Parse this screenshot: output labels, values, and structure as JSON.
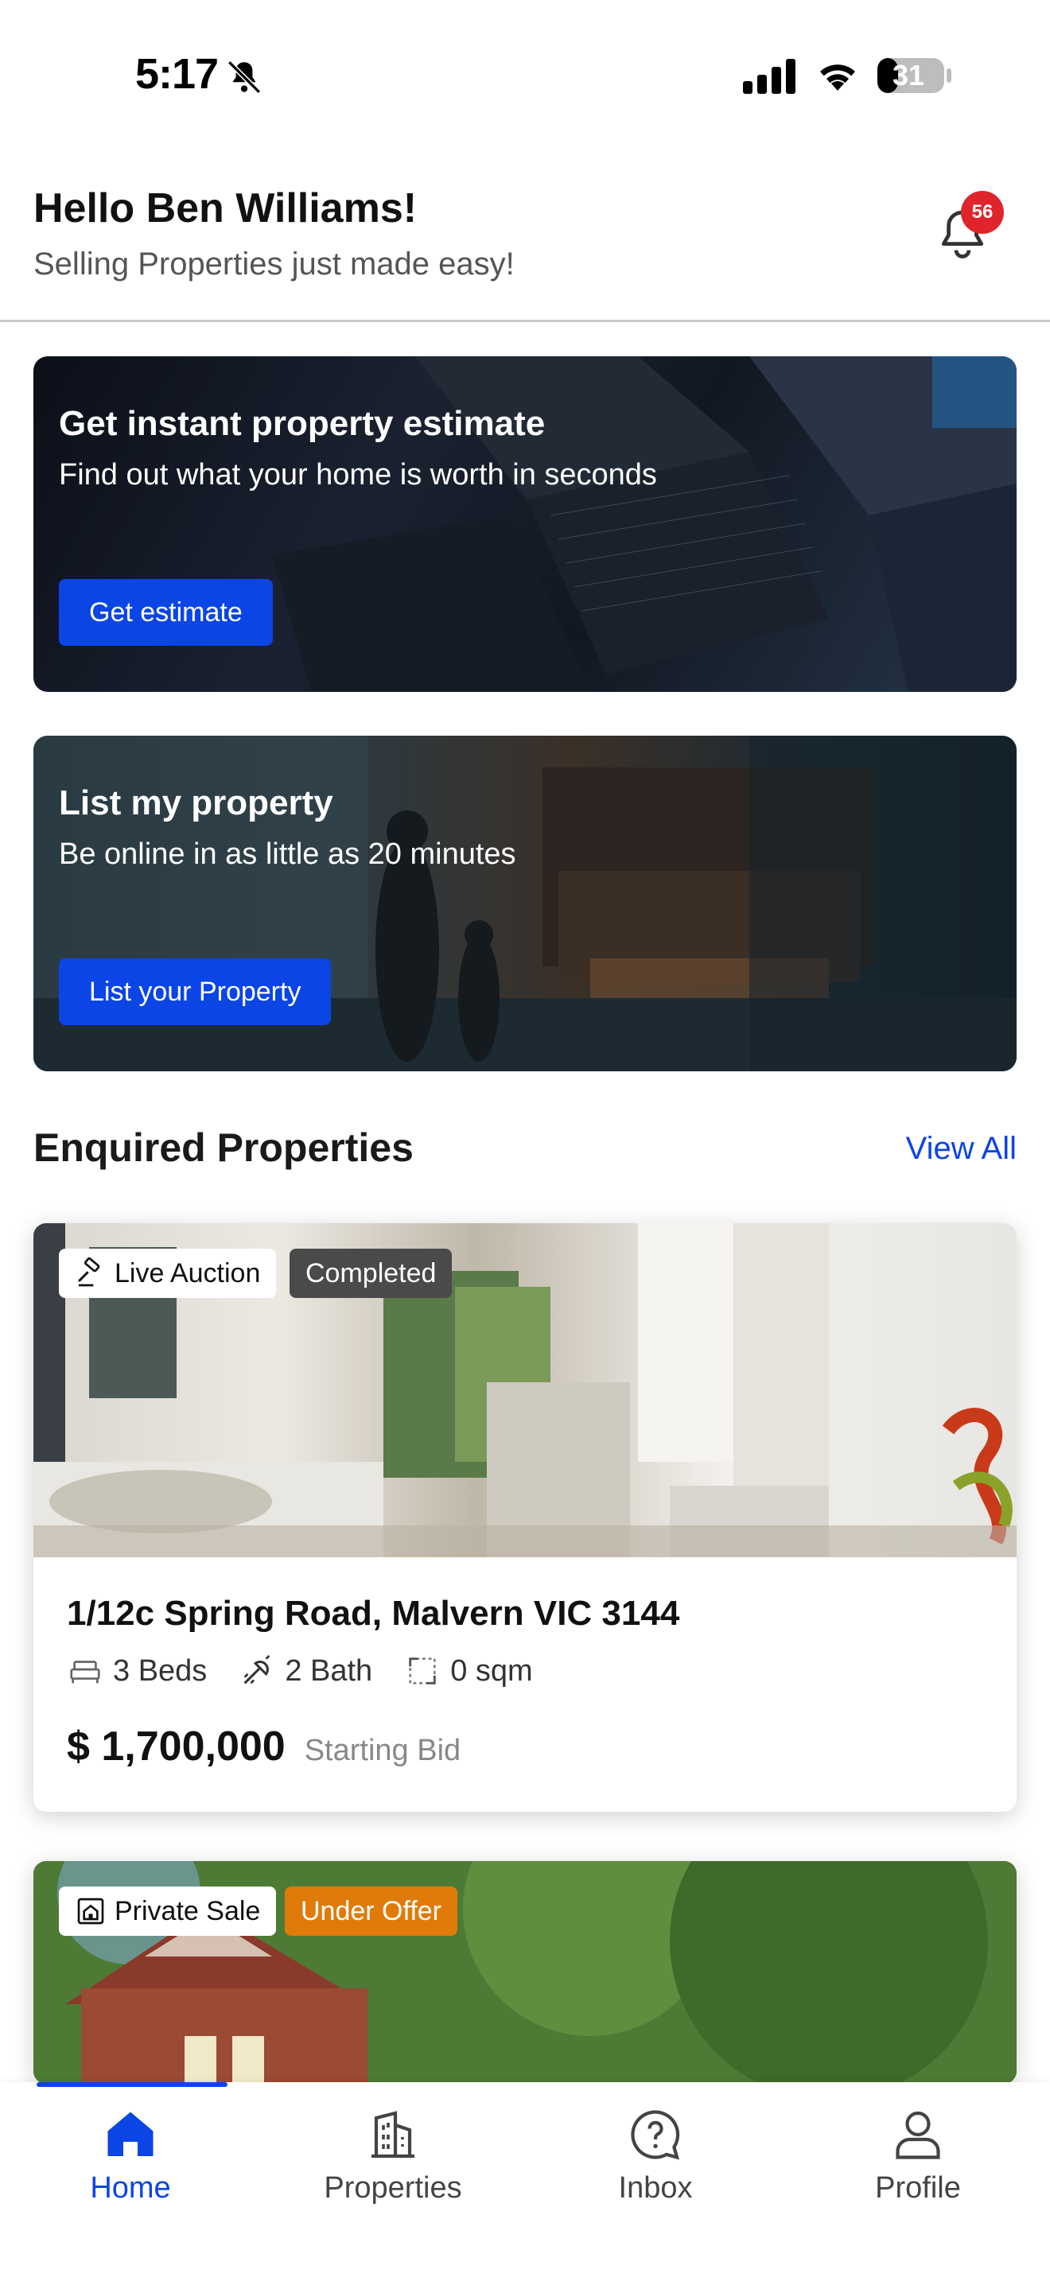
{
  "status_bar": {
    "time": "5:17",
    "battery": "31"
  },
  "header": {
    "greeting": "Hello Ben Williams!",
    "subtitle": "Selling Properties just made easy!",
    "notification_count": "56"
  },
  "promos": [
    {
      "title": "Get instant property estimate",
      "subtitle": "Find out what your home is worth in seconds",
      "button": "Get estimate"
    },
    {
      "title": "List my property",
      "subtitle": "Be online in as little as 20 minutes",
      "button": "List your Property"
    }
  ],
  "section": {
    "title": "Enquired Properties",
    "view_all": "View All"
  },
  "properties": [
    {
      "sale_type": "Live Auction",
      "status": "Completed",
      "address": "1/12c Spring Road, Malvern VIC 3144",
      "beds": "3 Beds",
      "baths": "2 Bath",
      "area": "0 sqm",
      "price": "$ 1,700,000",
      "price_note": "Starting Bid"
    },
    {
      "sale_type": "Private Sale",
      "status": "Under Offer"
    }
  ],
  "nav": [
    {
      "label": "Home",
      "icon": "home-icon",
      "active": true
    },
    {
      "label": "Properties",
      "icon": "building-icon",
      "active": false
    },
    {
      "label": "Inbox",
      "icon": "chat-question-icon",
      "active": false
    },
    {
      "label": "Profile",
      "icon": "user-icon",
      "active": false
    }
  ],
  "colors": {
    "accent": "#0b45e5",
    "badge": "#e0242c",
    "under_offer": "#e07b0a",
    "completed": "#4a4a4a"
  }
}
